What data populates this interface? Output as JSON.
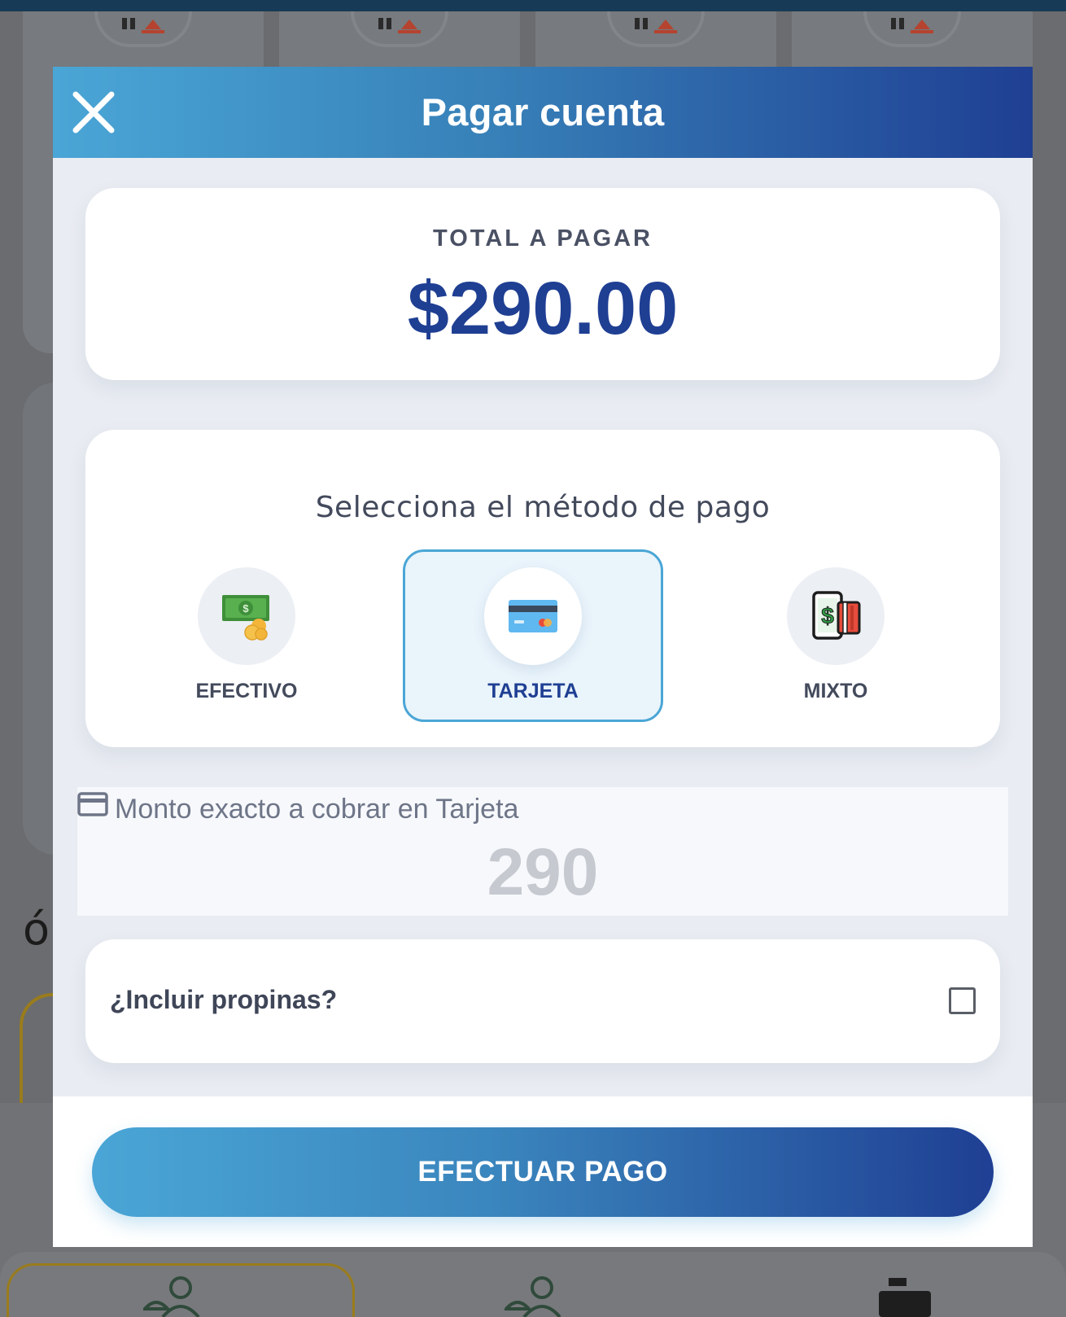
{
  "modal": {
    "title": "Pagar cuenta"
  },
  "total": {
    "label": "TOTAL A PAGAR",
    "amount": "$290.00"
  },
  "payment_methods": {
    "title": "Selecciona el método de pago",
    "selected": "TARJETA",
    "items": [
      {
        "label": "EFECTIVO",
        "icon": "cash-icon"
      },
      {
        "label": "TARJETA",
        "icon": "credit-card-icon"
      },
      {
        "label": "MIXTO",
        "icon": "mixed-payment-icon"
      }
    ]
  },
  "amount_field": {
    "label": "Monto exacto a cobrar en Tarjeta",
    "value": "290",
    "icon": "credit-card-outline-icon"
  },
  "tips": {
    "label": "¿Incluir propinas?",
    "checked": false
  },
  "footer": {
    "pay_button": "EFECTUAR PAGO"
  },
  "background": {
    "heading_fragment": "ó"
  },
  "colors": {
    "accent_start": "#4aa6d6",
    "accent_end": "#1f3f93",
    "total_amount": "#1f3f93",
    "overlay": "#6b6c6f"
  }
}
